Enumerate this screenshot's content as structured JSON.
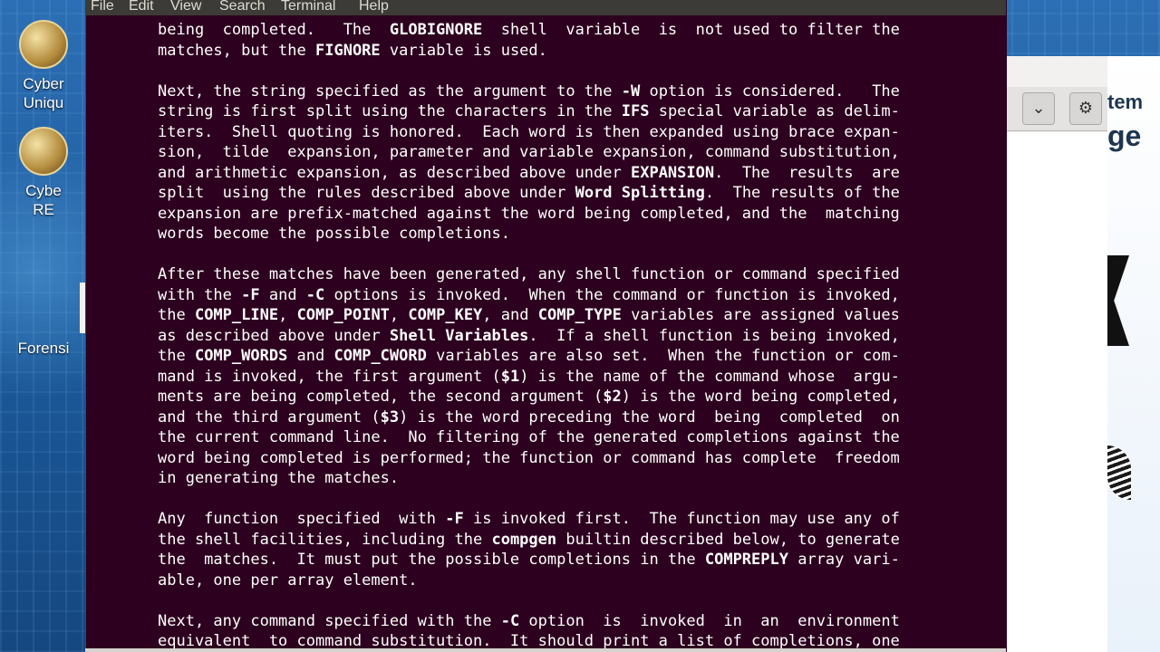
{
  "menubar": {
    "items": [
      "File",
      "Edit",
      "View",
      "Search",
      "Terminal",
      "Help"
    ]
  },
  "desktop_icons": [
    {
      "lines": [
        "Cyber",
        "Uniqu"
      ]
    },
    {
      "lines": [
        "Cybe",
        "RE"
      ]
    },
    {
      "lines": [
        "Forensi"
      ]
    }
  ],
  "background_window": {
    "page_text_1": "tem",
    "page_text_2": "ge",
    "dropdown_icon": "chevron-down-icon",
    "settings_icon": "gear-icon"
  },
  "terminal": {
    "lines": [
      [
        [
          "being  completed.   The  ",
          false
        ],
        [
          "GLOBIGNORE",
          true
        ],
        [
          "  shell  variable  is  not used to filter the",
          false
        ]
      ],
      [
        [
          "matches, but the ",
          false
        ],
        [
          "FIGNORE",
          true
        ],
        [
          " variable is used.",
          false
        ]
      ],
      [],
      [
        [
          "Next, the string specified as the argument to the ",
          false
        ],
        [
          "-W",
          true
        ],
        [
          " option is considered.   The",
          false
        ]
      ],
      [
        [
          "string is first split using the characters in the ",
          false
        ],
        [
          "IFS",
          true
        ],
        [
          " special variable as delim-",
          false
        ]
      ],
      [
        [
          "iters.  Shell quoting is honored.  Each word is then expanded using brace expan-",
          false
        ]
      ],
      [
        [
          "sion,  tilde  expansion, parameter and variable expansion, command substitution,",
          false
        ]
      ],
      [
        [
          "and arithmetic expansion, as described above under ",
          false
        ],
        [
          "EXPANSION",
          true
        ],
        [
          ".  The  results  are",
          false
        ]
      ],
      [
        [
          "split  using the rules described above under ",
          false
        ],
        [
          "Word Splitting",
          true
        ],
        [
          ".  The results of the",
          false
        ]
      ],
      [
        [
          "expansion are prefix-matched against the word being completed, and the  matching",
          false
        ]
      ],
      [
        [
          "words become the possible completions.",
          false
        ]
      ],
      [],
      [
        [
          "After these matches have been generated, any shell function or command specified",
          false
        ]
      ],
      [
        [
          "with the ",
          false
        ],
        [
          "-F",
          true
        ],
        [
          " and ",
          false
        ],
        [
          "-C",
          true
        ],
        [
          " options is invoked.  When the command or function is invoked,",
          false
        ]
      ],
      [
        [
          "the ",
          false
        ],
        [
          "COMP_LINE",
          true
        ],
        [
          ", ",
          false
        ],
        [
          "COMP_POINT",
          true
        ],
        [
          ", ",
          false
        ],
        [
          "COMP_KEY",
          true
        ],
        [
          ", and ",
          false
        ],
        [
          "COMP_TYPE",
          true
        ],
        [
          " variables are assigned values",
          false
        ]
      ],
      [
        [
          "as described above under ",
          false
        ],
        [
          "Shell Variables",
          true
        ],
        [
          ".  If a shell function is being invoked,",
          false
        ]
      ],
      [
        [
          "the ",
          false
        ],
        [
          "COMP_WORDS",
          true
        ],
        [
          " and ",
          false
        ],
        [
          "COMP_CWORD",
          true
        ],
        [
          " variables are also set.  When the function or com-",
          false
        ]
      ],
      [
        [
          "mand is invoked, the first argument (",
          false
        ],
        [
          "$1",
          true
        ],
        [
          ") is the name of the command whose  argu-",
          false
        ]
      ],
      [
        [
          "ments are being completed, the second argument (",
          false
        ],
        [
          "$2",
          true
        ],
        [
          ") is the word being completed,",
          false
        ]
      ],
      [
        [
          "and the third argument (",
          false
        ],
        [
          "$3",
          true
        ],
        [
          ") is the word preceding the word  being  completed  on",
          false
        ]
      ],
      [
        [
          "the current command line.  No filtering of the generated completions against the",
          false
        ]
      ],
      [
        [
          "word being completed is performed; the function or command has complete  freedom",
          false
        ]
      ],
      [
        [
          "in generating the matches.",
          false
        ]
      ],
      [],
      [
        [
          "Any  function  specified  with ",
          false
        ],
        [
          "-F",
          true
        ],
        [
          " is invoked first.  The function may use any of",
          false
        ]
      ],
      [
        [
          "the shell facilities, including the ",
          false
        ],
        [
          "compgen",
          true
        ],
        [
          " builtin described below, to generate",
          false
        ]
      ],
      [
        [
          "the  matches.  It must put the possible completions in the ",
          false
        ],
        [
          "COMPREPLY",
          true
        ],
        [
          " array vari-",
          false
        ]
      ],
      [
        [
          "able, one per array element.",
          false
        ]
      ],
      [],
      [
        [
          "Next, any command specified with the ",
          false
        ],
        [
          "-C",
          true
        ],
        [
          " option  is  invoked  in  an  environment",
          false
        ]
      ],
      [
        [
          "equivalent  to command substitution.  It should print a list of completions, one",
          false
        ]
      ]
    ]
  }
}
